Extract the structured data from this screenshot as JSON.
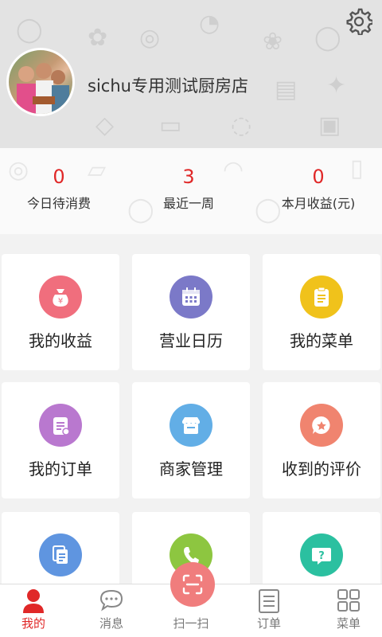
{
  "header": {
    "shop_name": "sichu专用测试厨房店",
    "settings_icon": "gear-icon",
    "background_color": "#e3e3e3"
  },
  "stats": [
    {
      "value": "0",
      "label": "今日待消费"
    },
    {
      "value": "3",
      "label": "最近一周"
    },
    {
      "value": "0",
      "label": "本月收益(元)"
    }
  ],
  "tiles": [
    {
      "label": "我的收益",
      "icon": "money-bag-icon",
      "color": "#f06e7d"
    },
    {
      "label": "营业日历",
      "icon": "calendar-icon",
      "color": "#7b79c8"
    },
    {
      "label": "我的菜单",
      "icon": "clipboard-icon",
      "color": "#f0c21b"
    },
    {
      "label": "我的订单",
      "icon": "order-list-icon",
      "color": "#b978cf"
    },
    {
      "label": "商家管理",
      "icon": "store-icon",
      "color": "#62aee6"
    },
    {
      "label": "收到的评价",
      "icon": "star-chat-icon",
      "color": "#f0846f"
    },
    {
      "label": "",
      "icon": "documents-icon",
      "color": "#5f95e0"
    },
    {
      "label": "",
      "icon": "phone-icon",
      "color": "#8dc640"
    },
    {
      "label": "",
      "icon": "question-chat-icon",
      "color": "#2bc0a0"
    }
  ],
  "nav": [
    {
      "label": "我的",
      "icon": "user-icon",
      "active": true
    },
    {
      "label": "消息",
      "icon": "message-icon",
      "active": false
    },
    {
      "label": "扫一扫",
      "icon": "scan-icon",
      "active": false
    },
    {
      "label": "订单",
      "icon": "order-icon",
      "active": false
    },
    {
      "label": "菜单",
      "icon": "grid-menu-icon",
      "active": false
    }
  ],
  "colors": {
    "accent_red": "#e02828",
    "scan_button": "#f07d7d"
  }
}
